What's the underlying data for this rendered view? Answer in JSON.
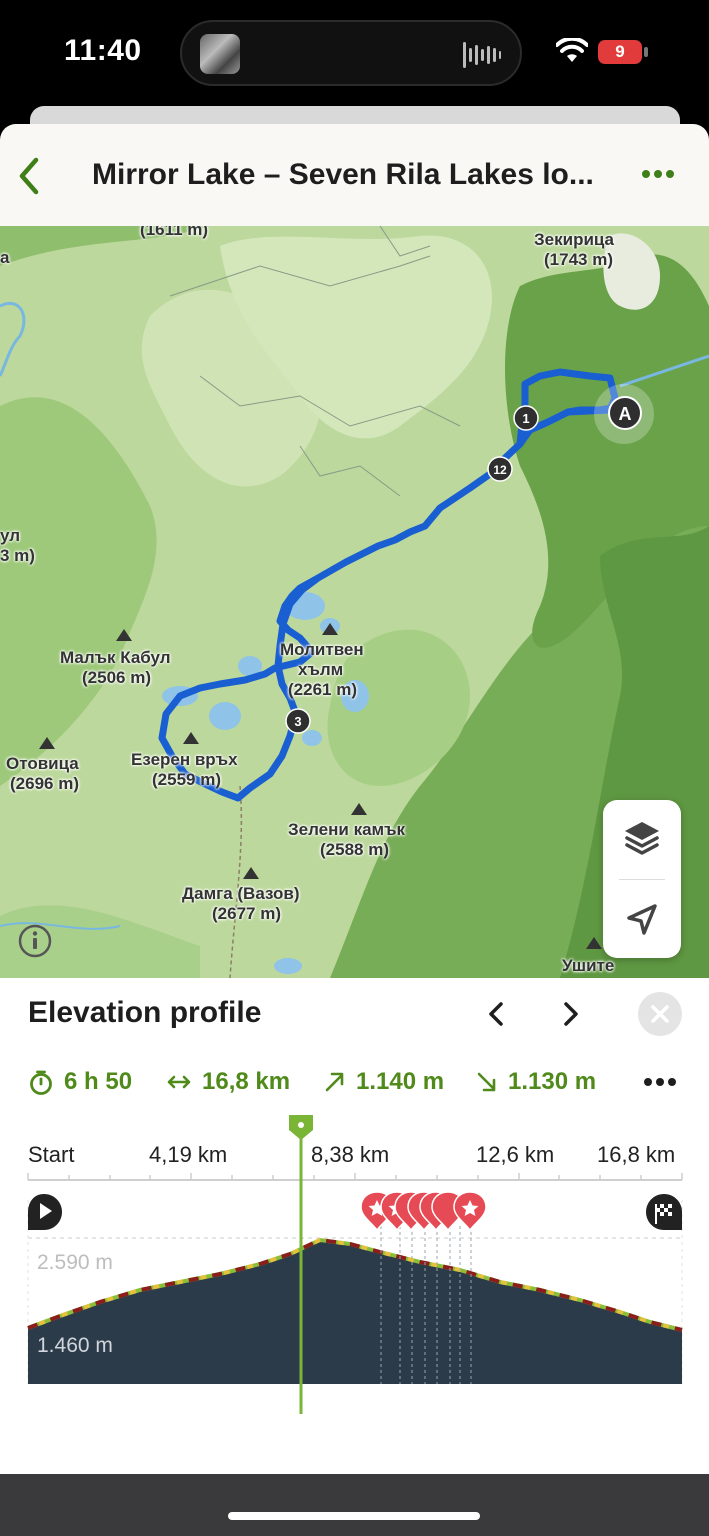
{
  "status_bar": {
    "time": "11:40",
    "battery": "9"
  },
  "header": {
    "title": "Mirror Lake – Seven Rila Lakes lo..."
  },
  "map": {
    "labels": {
      "top_partial": "(1611 m)",
      "zekiritsa": "Зекирица",
      "zekiritsa_elev": "(1743 m)",
      "left_partial_1": "а",
      "left_partial_2": "ул",
      "left_partial_3": "3 m)",
      "malak_kabul": "Малък Кабул",
      "malak_kabul_elev": "(2506 m)",
      "molitven": "Молитвен",
      "molitven_2": "хълм",
      "molitven_elev": "(2261 m)",
      "otovitsa": "Отовица",
      "otovitsa_elev": "(2696 m)",
      "ezeren": "Езерен връх",
      "ezeren_elev": "(2559 m)",
      "zeleni": "Зелени камък",
      "zeleni_elev": "(2588 m)",
      "damga": "Дамга (Вазов)",
      "damga_elev": "(2677 m)",
      "ushite": "Ушите"
    },
    "waypoints": {
      "start": "A",
      "w1": "1",
      "w12": "12",
      "w3": "3"
    }
  },
  "elevation": {
    "title": "Elevation profile",
    "stats": {
      "duration": "6 h 50",
      "distance": "16,8 km",
      "ascent": "1.140 m",
      "descent": "1.130 m"
    },
    "axis_labels": [
      "Start",
      "4,19 km",
      "8,38 km",
      "12,6 km",
      "16,8 km"
    ],
    "y_labels": {
      "max": "2.590 m",
      "min": "1.460 m"
    },
    "colors": {
      "accent": "#5a9a1f",
      "terrain": "#2c3b4a",
      "marker": "#e64a55"
    }
  }
}
